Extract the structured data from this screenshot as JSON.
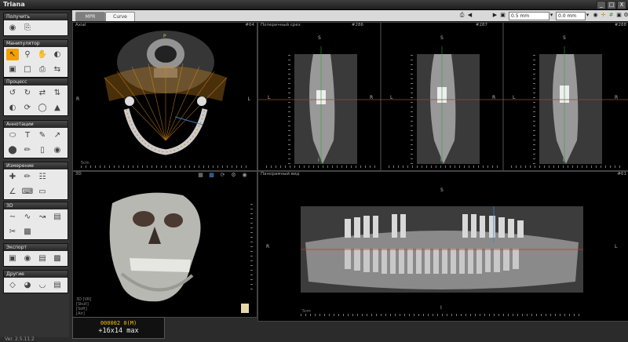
{
  "app": {
    "title": "Triana",
    "version": "Ver. 2.5.11.2"
  },
  "window_controls": [
    "_",
    "□",
    "X"
  ],
  "sidebar": {
    "panels": [
      {
        "label": "Получить"
      },
      {
        "label": "Манипулятор"
      },
      {
        "label": "Процесс"
      },
      {
        "label": "Аннотации"
      },
      {
        "label": "Измерение"
      },
      {
        "label": "3D"
      },
      {
        "label": "Экспорт"
      },
      {
        "label": "Другие"
      }
    ]
  },
  "tabs": [
    {
      "label": "MPR"
    },
    {
      "label": "Curve"
    }
  ],
  "toolbar": {
    "thickness": "0.5 mm",
    "interval": "0.0 mm"
  },
  "panes": {
    "axial": {
      "label": "Axial",
      "num": "#64",
      "orient_top": "P",
      "orient_left": "R",
      "orient_right": "L",
      "scale": "5cm"
    },
    "cross": {
      "label": "Поперечный срез",
      "slices": [
        {
          "num": "#286"
        },
        {
          "num": "#287"
        },
        {
          "num": "#288"
        }
      ],
      "orient_top": "S",
      "orient_bottom": "I",
      "orient_left": "L",
      "orient_right": "R"
    },
    "volume": {
      "label": "3D",
      "info": [
        "3D [VR]",
        "[Skull]",
        "[Soft]",
        "[Air]"
      ]
    },
    "panorama": {
      "label": "Панорамный вид",
      "num": "#61",
      "orient_top": "S",
      "orient_bottom": "I",
      "orient_left": "R",
      "orient_right": "L",
      "scale": "5cm"
    }
  },
  "status": {
    "line1": "000002 0(M)",
    "line2": "+16x14 max"
  },
  "colors": {
    "accent": "#f0a000",
    "cursor_line": "#c83030",
    "panel_bg": "#e9e9e9"
  }
}
